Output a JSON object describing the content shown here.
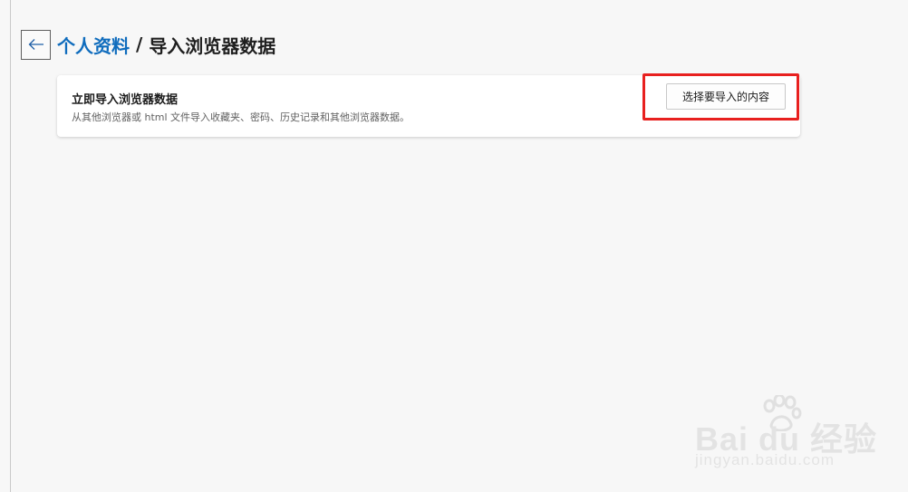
{
  "header": {
    "back_icon": "arrow-left-icon",
    "breadcrumb_parent": "个人资料",
    "breadcrumb_separator": "/",
    "breadcrumb_current": "导入浏览器数据"
  },
  "import_card": {
    "title": "立即导入浏览器数据",
    "description": "从其他浏览器或 html 文件导入收藏夹、密码、历史记录和其他浏览器数据。",
    "button_label": "选择要导入的内容"
  },
  "watermark": {
    "main": "Bai du 经验",
    "sub": "jingyan.baidu.com"
  },
  "colors": {
    "accent": "#0f6cbd",
    "highlight": "#e8201f",
    "background": "#f7f7f7"
  }
}
